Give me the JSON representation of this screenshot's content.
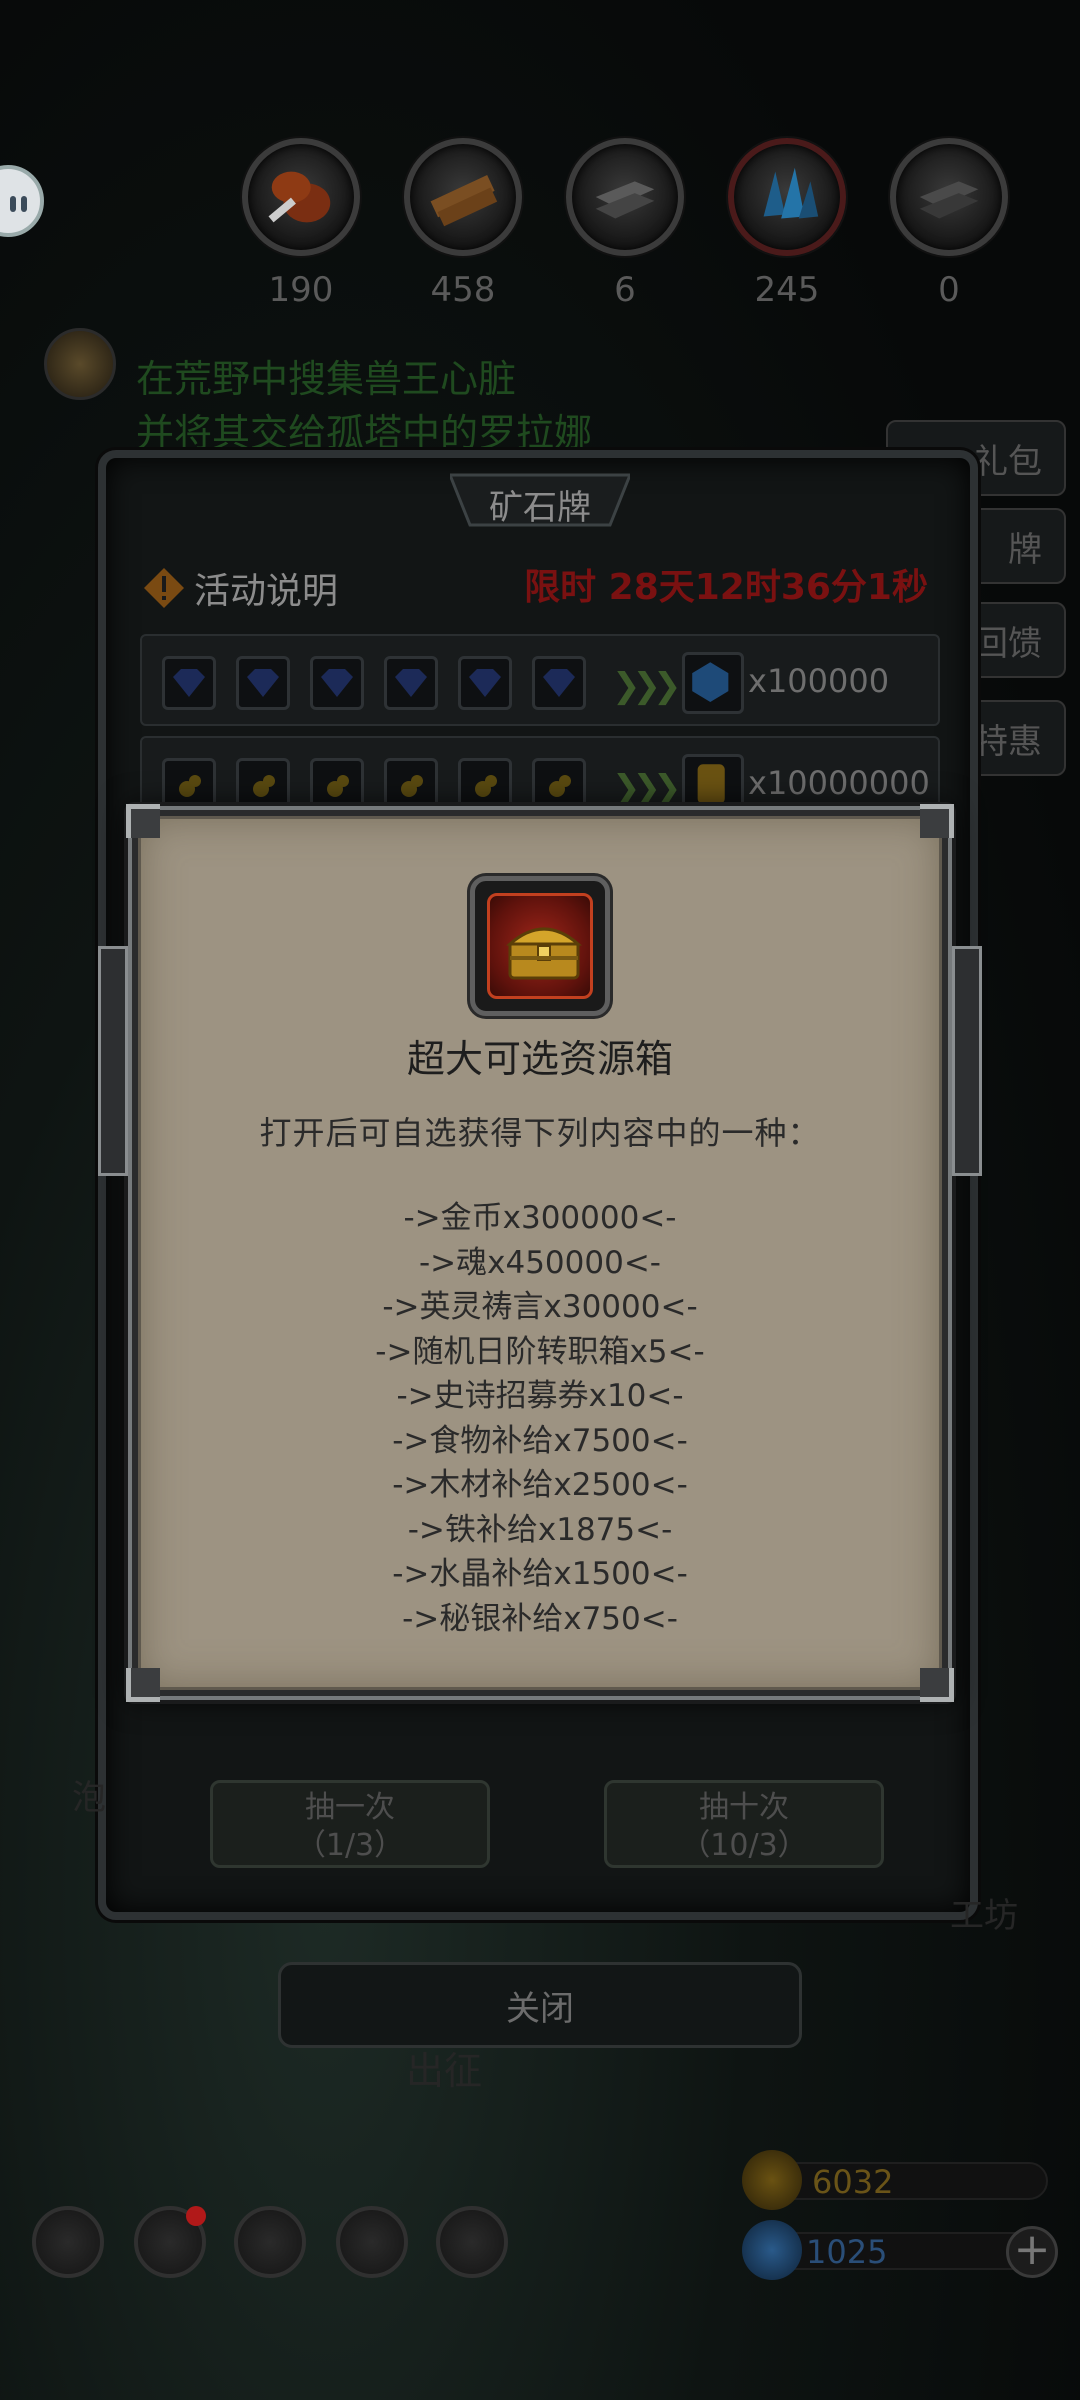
{
  "resources": [
    {
      "name": "meat",
      "count": "190",
      "color": "#b8561f"
    },
    {
      "name": "wood",
      "count": "458",
      "color": "#b17a3c"
    },
    {
      "name": "iron",
      "count": "6",
      "color": "#8a8a8a"
    },
    {
      "name": "crystal",
      "count": "245",
      "color": "#3aa0e8"
    },
    {
      "name": "mithril",
      "count": "0",
      "color": "#777777"
    }
  ],
  "quest": {
    "line1": "在荒野中搜集兽王心脏",
    "line2": "并将其交给孤塔中的罗拉娜"
  },
  "right_tabs": [
    "礼包",
    "牌",
    "回馈",
    "特惠"
  ],
  "panel": {
    "title": "矿石牌",
    "info_label": "活动说明",
    "timer": "限时 28天12时36分1秒",
    "rows": [
      {
        "amount": "x100000",
        "icon": "diamond-icon"
      },
      {
        "amount": "x10000000",
        "icon": "gold-coin-icon"
      }
    ],
    "draw_once": {
      "label": "抽一次",
      "count": "（1/3）"
    },
    "draw_ten": {
      "label": "抽十次",
      "count": "（10/3）"
    },
    "close": "关闭",
    "chuzheng": "出征",
    "gongfang": "工坊",
    "left_clipped": "泡"
  },
  "currencies": {
    "gold": "6032",
    "diamond": "1025"
  },
  "popup": {
    "title": "超大可选资源箱",
    "description": "打开后可自选获得下列内容中的一种：",
    "options": [
      "->金币x300000<-",
      "->魂x450000<-",
      "->英灵祷言x30000<-",
      "->随机日阶转职箱x5<-",
      "->史诗招募券x10<-",
      "->食物补给x7500<-",
      "->木材补给x2500<-",
      "->铁补给x1875<-",
      "->水晶补给x1500<-",
      "->秘银补给x750<-"
    ]
  }
}
